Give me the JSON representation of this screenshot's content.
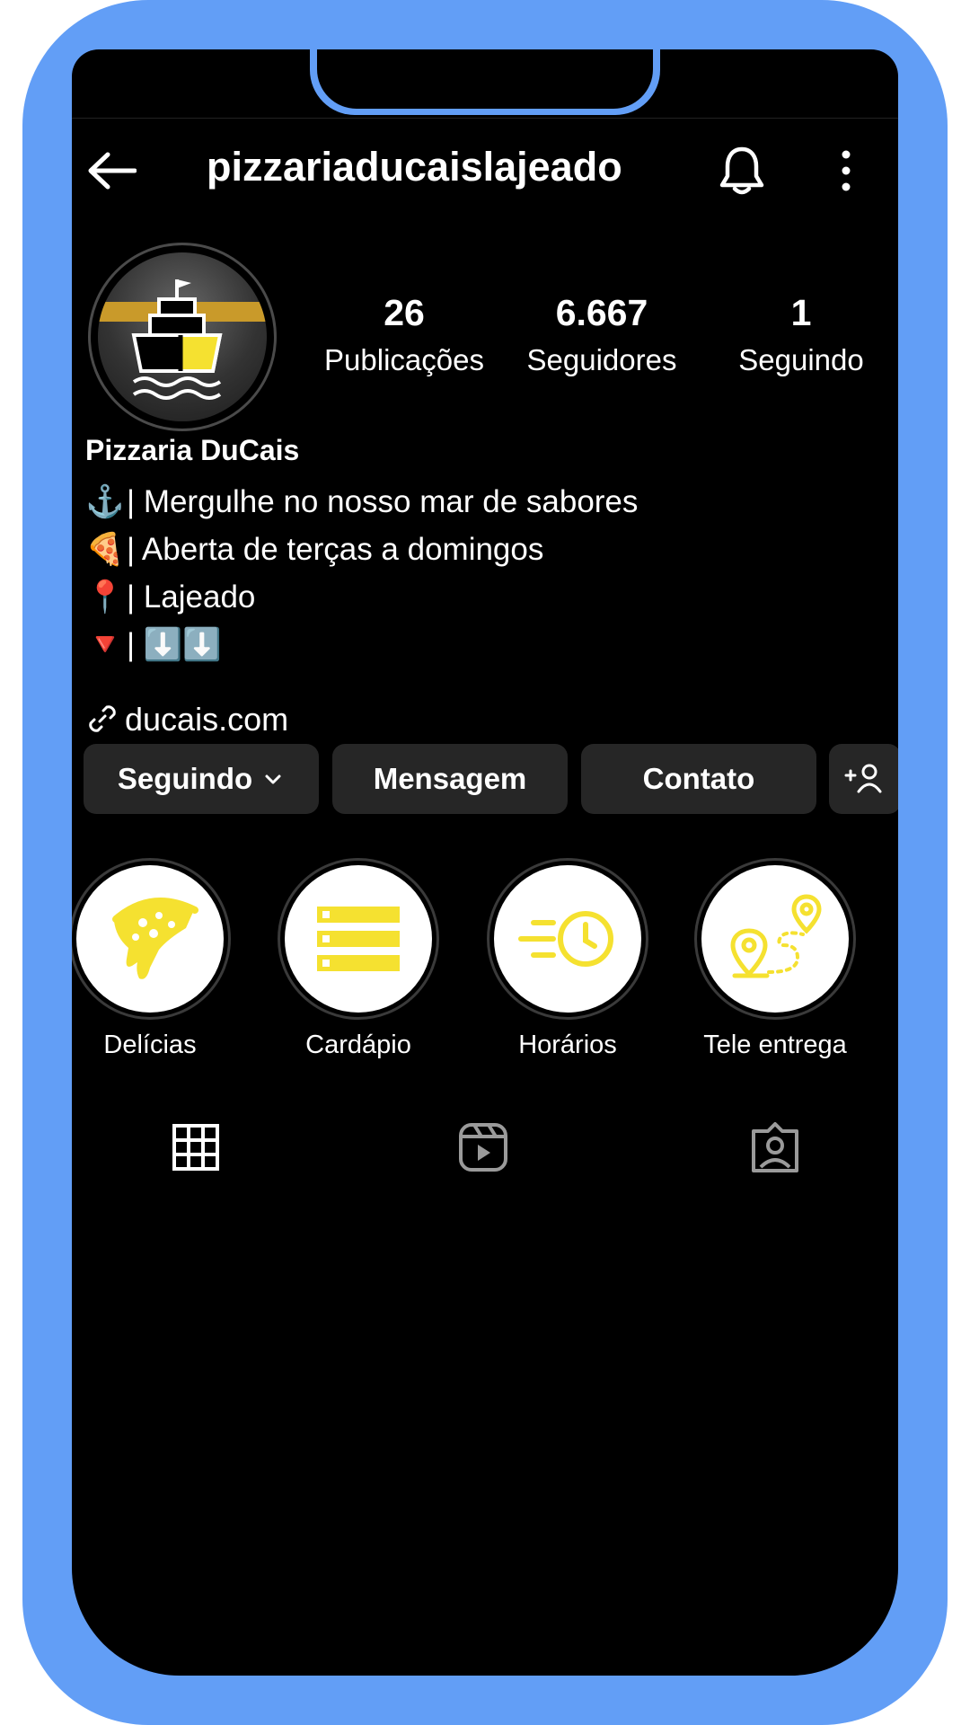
{
  "header": {
    "username": "pizzariaducaislajeado"
  },
  "stats": [
    {
      "value": "26",
      "label": "Publicações"
    },
    {
      "value": "6.667",
      "label": "Seguidores"
    },
    {
      "value": "1",
      "label": "Seguindo"
    }
  ],
  "profile": {
    "name": "Pizzaria DuCais",
    "bio": [
      {
        "emoji": "⚓",
        "text": "| Mergulhe no nosso mar de sabores"
      },
      {
        "emoji": "🍕",
        "text": "| Aberta de terças a domingos"
      },
      {
        "emoji": "📍",
        "text": "| Lajeado"
      },
      {
        "emoji": "🔻",
        "text": "| ⬇️⬇️"
      }
    ],
    "link": "ducais.com"
  },
  "buttons": {
    "following": "Seguindo",
    "message": "Mensagem",
    "contact": "Contato"
  },
  "highlights": [
    {
      "label": "Delícias",
      "icon": "pizza-slice-icon"
    },
    {
      "label": "Cardápio",
      "icon": "menu-list-icon"
    },
    {
      "label": "Horários",
      "icon": "fast-clock-icon"
    },
    {
      "label": "Tele entrega",
      "icon": "delivery-route-icon"
    }
  ],
  "tabs": [
    {
      "icon": "grid-icon"
    },
    {
      "icon": "reels-icon"
    },
    {
      "icon": "tagged-icon"
    }
  ],
  "colors": {
    "frame": "#629ef6",
    "accent": "#f5e130",
    "background": "#000000",
    "button": "#262626"
  }
}
